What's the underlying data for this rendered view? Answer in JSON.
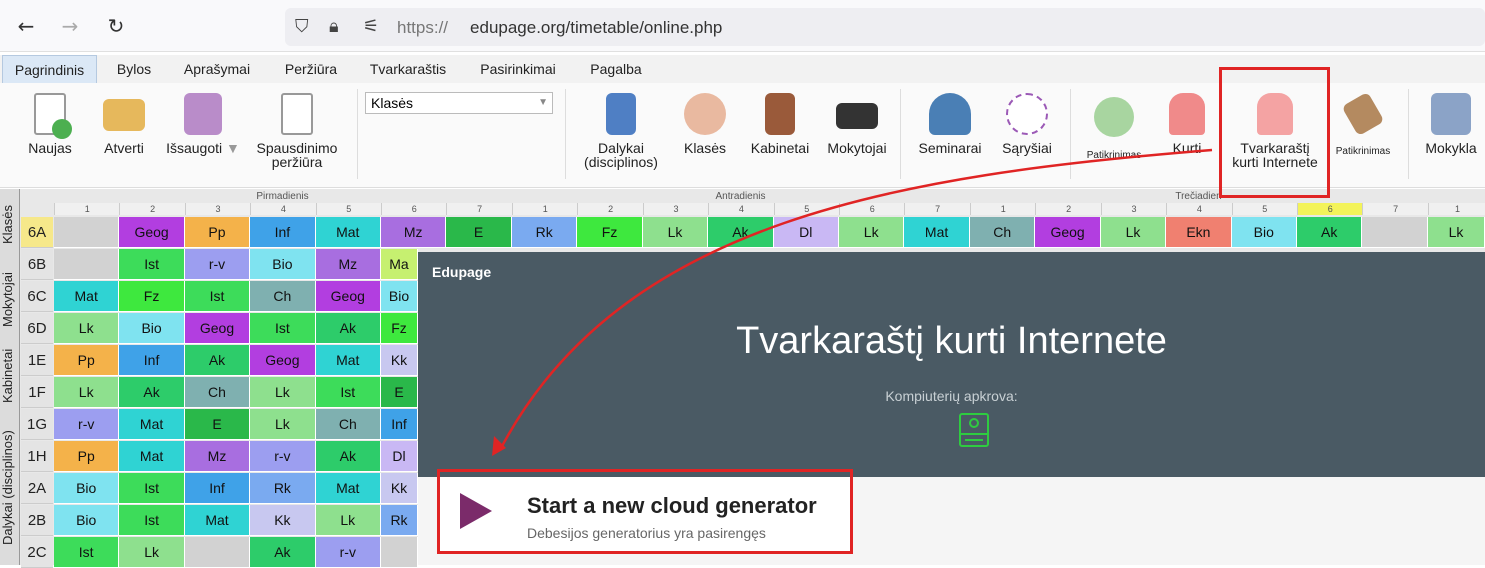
{
  "browser": {
    "url_prefix": "https://",
    "url_domain": "edupage.org/timetable/online.php"
  },
  "menu": {
    "tabs": [
      "Pagrindinis",
      "Bylos",
      "Aprašymai",
      "Peržiūra",
      "Tvarkaraštis",
      "Pasirinkimai",
      "Pagalba"
    ],
    "active": "Pagrindinis"
  },
  "ribbon": {
    "naujas": "Naujas",
    "atverti": "Atverti",
    "issaugoti": "Išsaugoti",
    "spausdinimo_1": "Spausdinimo",
    "spausdinimo_2": "peržiūra",
    "select_value": "Klasės",
    "dalykai_1": "Dalykai",
    "dalykai_2": "(disciplinos)",
    "klases": "Klasės",
    "kabinetai": "Kabinetai",
    "mokytojai": "Mokytojai",
    "seminarai": "Seminarai",
    "sarysiai": "Sąryšiai",
    "patikrinimas_1": "Patikrinimas",
    "kurti": "Kurti",
    "tvarkarastij_1": "Tvarkaraštį",
    "tvarkarastij_2": "kurti Internete",
    "patikrinimas_2": "Patikrinimas",
    "mokykla": "Mokykla"
  },
  "side_tabs": [
    "Klasės",
    "Mokytojai",
    "Kabinetai",
    "Dalykai (disciplinos)"
  ],
  "timetable": {
    "days": [
      "Pirmadienis",
      "Antradienis",
      "Trečiadien"
    ],
    "periods": [
      "1",
      "2",
      "3",
      "4",
      "5",
      "6",
      "7"
    ],
    "highlight_period_wed": "6",
    "classes": [
      "6A",
      "6B",
      "6C",
      "6D",
      "1E",
      "1F",
      "1G",
      "1H",
      "2A",
      "2B",
      "2C"
    ],
    "row_6A": [
      "",
      "Geog",
      "Pp",
      "Inf",
      "Mat",
      "Mz",
      "E",
      "Rk",
      "Fz",
      "Lk",
      "Ak",
      "Dl",
      "Lk",
      "Mat",
      "Ch",
      "Geog",
      "Lk",
      "Ekn",
      "Bio",
      "Ak",
      "",
      "Lk"
    ],
    "rows_mon_visible": [
      [
        "",
        "Ist",
        "r-v",
        "Bio",
        "Mz",
        "Ma"
      ],
      [
        "Mat",
        "Fz",
        "Ist",
        "Ch",
        "Geog",
        "Bio"
      ],
      [
        "Lk",
        "Bio",
        "Geog",
        "Ist",
        "Ak",
        "Fz"
      ],
      [
        "Pp",
        "Inf",
        "Ak",
        "Geog",
        "Mat",
        "Kk"
      ],
      [
        "Lk",
        "Ak",
        "Ch",
        "Lk",
        "Ist",
        "E"
      ],
      [
        "r-v",
        "Mat",
        "E",
        "Lk",
        "Ch",
        "Inf"
      ],
      [
        "Pp",
        "Mat",
        "Mz",
        "r-v",
        "Ak",
        "Dl"
      ],
      [
        "Bio",
        "Ist",
        "Inf",
        "Rk",
        "Mat",
        "Kk"
      ],
      [
        "Bio",
        "Ist",
        "Mat",
        "Kk",
        "Lk",
        "Rk"
      ],
      [
        "Ist",
        "Lk",
        "",
        "Ak",
        "r-v",
        ""
      ]
    ]
  },
  "overlay": {
    "brand": "Edupage",
    "title": "Tvarkaraštį kurti Internete",
    "subtitle": "Kompiuterių apkrova:"
  },
  "generator": {
    "title": "Start a new cloud generator",
    "subtitle": "Debesijos generatorius yra pasirengęs"
  },
  "colors": {
    "annotation": "#e02424",
    "overlay_bg": "#4a5a64",
    "play": "#7b2b6a"
  }
}
